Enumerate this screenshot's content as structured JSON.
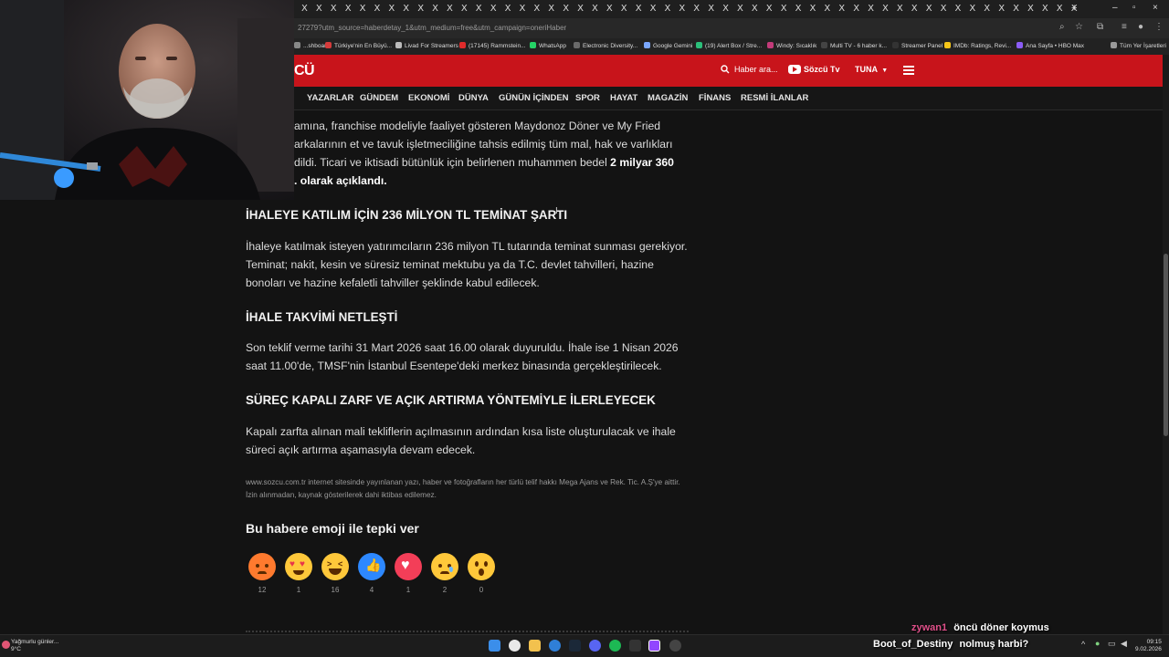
{
  "browser": {
    "tab_glyph": "X",
    "tab_count": 54,
    "new_tab": "+",
    "window_buttons": [
      "–",
      "▫",
      "×"
    ],
    "url": "27279?utm_source=haberdetay_1&utm_medium=free&utm_campaign=oneriHaber",
    "bookmarks": [
      {
        "label": "...shboard",
        "color": "#888888"
      },
      {
        "label": "Türkiye'nin En Büyü...",
        "color": "#d63b3b"
      },
      {
        "label": "Livad For Streamers",
        "color": "#bbbbbb"
      },
      {
        "label": "(17145) Rammstein...",
        "color": "#e02b2b"
      },
      {
        "label": "WhatsApp",
        "color": "#25d366"
      },
      {
        "label": "Electronic Diversity...",
        "color": "#6a6a6a"
      },
      {
        "label": "Google Gemini",
        "color": "#7aa7ff"
      },
      {
        "label": "(19) Alert Box / Stre...",
        "color": "#2bbf7a"
      },
      {
        "label": "Windy: Sıcaklık",
        "color": "#c33b7a"
      },
      {
        "label": "Multi TV - 6 haber k...",
        "color": "#444444"
      },
      {
        "label": "Streamer Panel",
        "color": "#333333"
      },
      {
        "label": "IMDb: Ratings, Revi...",
        "color": "#f5c518"
      },
      {
        "label": "Ana Sayfa • HBO Max",
        "color": "#8b5cf6"
      },
      {
        "label": "Tüm Yer İşaretleri",
        "color": "#999999"
      }
    ]
  },
  "site": {
    "logo": "CÜ",
    "search_placeholder": "Haber ara...",
    "tv_label": "Sözcü Tv",
    "user_label": "TUNA",
    "nav": [
      "YAZARLAR",
      "GÜNDEM",
      "EKONOMİ",
      "DÜNYA",
      "GÜNÜN İÇİNDEN",
      "SPOR",
      "HAYAT",
      "MAGAZİN",
      "FİNANS",
      "RESMİ İLANLAR"
    ]
  },
  "article": {
    "intro_lines": [
      "amına, franchise modeliyle faaliyet gösteren Maydonoz Döner ve My Fried",
      "arkalarının et ve tavuk işletmeciliğine tahsis edilmiş tüm mal, hak ve varlıkları",
      "dildi. Ticari ve iktisadi bütünlük için belirlenen muhammen bedel"
    ],
    "intro_bold_1": "2 milyar 360",
    "intro_bold_2": ". olarak açıklandı.",
    "h1": "İHALEYE KATILIM İÇİN 236 MİLYON TL TEMİNAT ŞARTI",
    "p1": "İhaleye katılmak isteyen yatırımcıların 236 milyon TL tutarında teminat sunması gerekiyor. Teminat; nakit, kesin ve süresiz teminat mektubu ya da T.C. devlet tahvilleri, hazine bonoları ve hazine kefaletli tahviller şeklinde kabul edilecek.",
    "h2": "İHALE TAKVİMİ NETLEŞTİ",
    "p2": "Son teklif verme tarihi 31 Mart 2026 saat 16.00 olarak duyuruldu. İhale ise 1 Nisan 2026 saat 11.00'de, TMSF'nin İstanbul Esentepe'deki merkez binasında gerçekleştirilecek.",
    "h3": "SÜREÇ KAPALI ZARF VE AÇIK ARTIRMA YÖNTEMİYLE İLERLEYECEK",
    "p3": "Kapalı zarfta alınan mali tekliflerin açılmasının ardından kısa liste oluşturulacak ve ihale süreci açık artırma aşamasıyla devam edecek.",
    "copyright": "www.sozcu.com.tr internet sitesinde yayınlanan yazı, haber ve fotoğrafların her türlü telif hakkı Mega Ajans ve Rek. Tic. A.Ş'ye aittir. İzin alınmadan, kaynak gösterilerek dahi iktibas edilemez.",
    "reaction_title": "Bu habere emoji ile tepki ver",
    "reactions": [
      {
        "name": "angry",
        "count": "12"
      },
      {
        "name": "love",
        "count": "1"
      },
      {
        "name": "laugh",
        "count": "16"
      },
      {
        "name": "like",
        "count": "4"
      },
      {
        "name": "heart",
        "count": "1"
      },
      {
        "name": "sad",
        "count": "2"
      },
      {
        "name": "surprised",
        "count": "0"
      }
    ]
  },
  "taskbar": {
    "weather_line1": "Yağmurlu günler...",
    "weather_line2": "9°C",
    "time": "09:15",
    "date": "9.02.2026"
  },
  "chat": [
    {
      "user": "zywan1",
      "message": "öncü döner koymus",
      "user_color": "#e0508a"
    },
    {
      "user": "Boot_of_Destiny",
      "message": "nolmuş harbi?",
      "user_color": "#ffffff"
    }
  ]
}
